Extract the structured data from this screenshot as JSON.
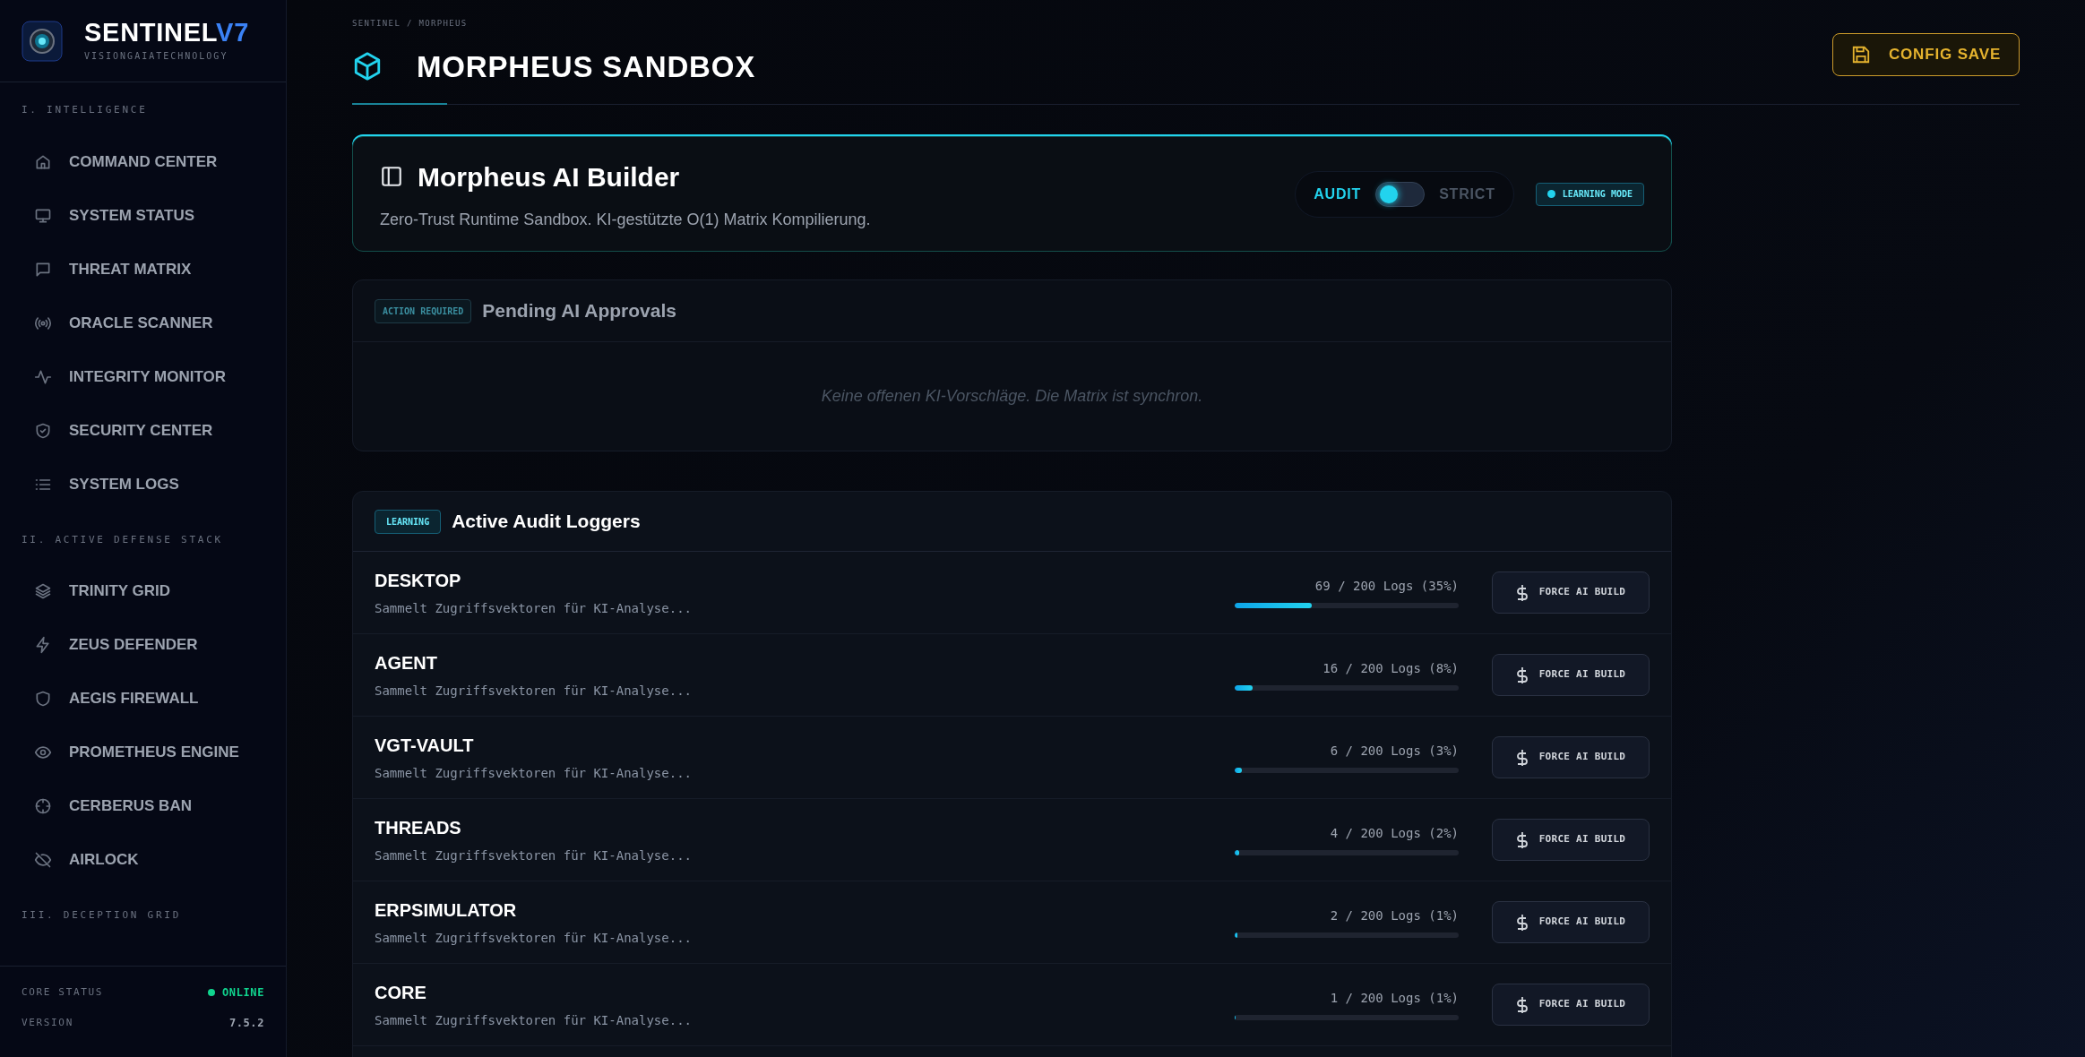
{
  "brand": {
    "name": "SENTINEL",
    "version_mark": "V7",
    "tagline": "VISIONGAIATECHNOLOGY"
  },
  "sidebar": {
    "sections": [
      {
        "title": "I. INTELLIGENCE",
        "items": [
          "COMMAND CENTER",
          "SYSTEM STATUS",
          "THREAT MATRIX",
          "ORACLE SCANNER",
          "INTEGRITY MONITOR",
          "SECURITY CENTER",
          "SYSTEM LOGS"
        ]
      },
      {
        "title": "II. ACTIVE DEFENSE STACK",
        "items": [
          "TRINITY GRID",
          "ZEUS DEFENDER",
          "AEGIS FIREWALL",
          "PROMETHEUS ENGINE",
          "CERBERUS BAN",
          "AIRLOCK"
        ]
      },
      {
        "title": "III. DECEPTION GRID"
      }
    ],
    "footer": [
      {
        "label": "CORE STATUS",
        "value": "ONLINE",
        "online": true
      },
      {
        "label": "VERSION",
        "value": "7.5.2",
        "online": false
      }
    ]
  },
  "breadcrumb": "SENTINEL / MORPHEUS",
  "page_title": "MORPHEUS SANDBOX",
  "config_button": "CONFIG SAVE",
  "builder": {
    "title": "Morpheus AI Builder",
    "subtitle": "Zero-Trust Runtime Sandbox. KI-gestützte O(1) Matrix Kompilierung.",
    "mode_options": [
      {
        "label": "AUDIT",
        "selected": true
      },
      {
        "label": "STRICT",
        "selected": false
      }
    ],
    "badge": "LEARNING MODE"
  },
  "approvals": {
    "badge": "ACTION REQUIRED",
    "title": "Pending AI Approvals",
    "empty_text": "Keine offenen KI-Vorschläge. Die Matrix ist synchron."
  },
  "loggers": {
    "badge": "LEARNING",
    "title": "Active Audit Loggers",
    "rows": [
      {
        "name": "DESKTOP",
        "description": "Sammelt Zugriffsvektoren für KI-Analyse...",
        "reading": "69 / 200 Logs (35%)",
        "level": 0.345,
        "button": "FORCE AI BUILD"
      },
      {
        "name": "AGENT",
        "description": "Sammelt Zugriffsvektoren für KI-Analyse...",
        "reading": "16 / 200 Logs (8%)",
        "level": 0.08,
        "button": "FORCE AI BUILD"
      },
      {
        "name": "VGT-VAULT",
        "description": "Sammelt Zugriffsvektoren für KI-Analyse...",
        "reading": "6 / 200 Logs (3%)",
        "level": 0.03,
        "button": "FORCE AI BUILD"
      },
      {
        "name": "THREADS",
        "description": "Sammelt Zugriffsvektoren für KI-Analyse...",
        "reading": "4 / 200 Logs (2%)",
        "level": 0.02,
        "button": "FORCE AI BUILD"
      },
      {
        "name": "ERPSIMULATOR",
        "description": "Sammelt Zugriffsvektoren für KI-Analyse...",
        "reading": "2 / 200 Logs (1%)",
        "level": 0.01,
        "button": "FORCE AI BUILD"
      },
      {
        "name": "CORE",
        "description": "Sammelt Zugriffsvektoren für KI-Analyse...",
        "reading": "1 / 200 Logs (1%)",
        "level": 0.005,
        "button": "FORCE AI BUILD"
      }
    ]
  }
}
